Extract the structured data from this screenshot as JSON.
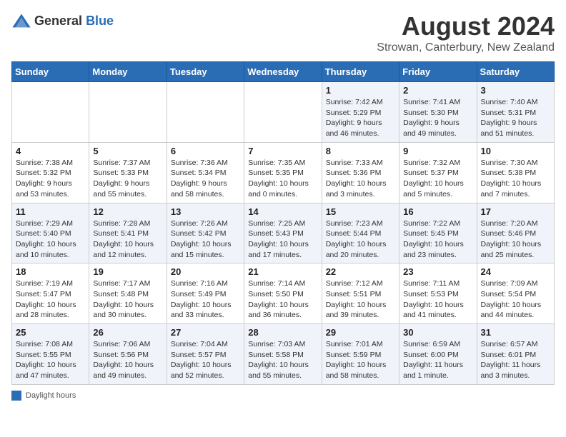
{
  "header": {
    "logo_general": "General",
    "logo_blue": "Blue",
    "main_title": "August 2024",
    "sub_title": "Strowan, Canterbury, New Zealand"
  },
  "days_of_week": [
    "Sunday",
    "Monday",
    "Tuesday",
    "Wednesday",
    "Thursday",
    "Friday",
    "Saturday"
  ],
  "footer": {
    "label": "Daylight hours"
  },
  "weeks": [
    [
      {
        "day": "",
        "info": ""
      },
      {
        "day": "",
        "info": ""
      },
      {
        "day": "",
        "info": ""
      },
      {
        "day": "",
        "info": ""
      },
      {
        "day": "1",
        "info": "Sunrise: 7:42 AM\nSunset: 5:29 PM\nDaylight: 9 hours and 46 minutes."
      },
      {
        "day": "2",
        "info": "Sunrise: 7:41 AM\nSunset: 5:30 PM\nDaylight: 9 hours and 49 minutes."
      },
      {
        "day": "3",
        "info": "Sunrise: 7:40 AM\nSunset: 5:31 PM\nDaylight: 9 hours and 51 minutes."
      }
    ],
    [
      {
        "day": "4",
        "info": "Sunrise: 7:38 AM\nSunset: 5:32 PM\nDaylight: 9 hours and 53 minutes."
      },
      {
        "day": "5",
        "info": "Sunrise: 7:37 AM\nSunset: 5:33 PM\nDaylight: 9 hours and 55 minutes."
      },
      {
        "day": "6",
        "info": "Sunrise: 7:36 AM\nSunset: 5:34 PM\nDaylight: 9 hours and 58 minutes."
      },
      {
        "day": "7",
        "info": "Sunrise: 7:35 AM\nSunset: 5:35 PM\nDaylight: 10 hours and 0 minutes."
      },
      {
        "day": "8",
        "info": "Sunrise: 7:33 AM\nSunset: 5:36 PM\nDaylight: 10 hours and 3 minutes."
      },
      {
        "day": "9",
        "info": "Sunrise: 7:32 AM\nSunset: 5:37 PM\nDaylight: 10 hours and 5 minutes."
      },
      {
        "day": "10",
        "info": "Sunrise: 7:30 AM\nSunset: 5:38 PM\nDaylight: 10 hours and 7 minutes."
      }
    ],
    [
      {
        "day": "11",
        "info": "Sunrise: 7:29 AM\nSunset: 5:40 PM\nDaylight: 10 hours and 10 minutes."
      },
      {
        "day": "12",
        "info": "Sunrise: 7:28 AM\nSunset: 5:41 PM\nDaylight: 10 hours and 12 minutes."
      },
      {
        "day": "13",
        "info": "Sunrise: 7:26 AM\nSunset: 5:42 PM\nDaylight: 10 hours and 15 minutes."
      },
      {
        "day": "14",
        "info": "Sunrise: 7:25 AM\nSunset: 5:43 PM\nDaylight: 10 hours and 17 minutes."
      },
      {
        "day": "15",
        "info": "Sunrise: 7:23 AM\nSunset: 5:44 PM\nDaylight: 10 hours and 20 minutes."
      },
      {
        "day": "16",
        "info": "Sunrise: 7:22 AM\nSunset: 5:45 PM\nDaylight: 10 hours and 23 minutes."
      },
      {
        "day": "17",
        "info": "Sunrise: 7:20 AM\nSunset: 5:46 PM\nDaylight: 10 hours and 25 minutes."
      }
    ],
    [
      {
        "day": "18",
        "info": "Sunrise: 7:19 AM\nSunset: 5:47 PM\nDaylight: 10 hours and 28 minutes."
      },
      {
        "day": "19",
        "info": "Sunrise: 7:17 AM\nSunset: 5:48 PM\nDaylight: 10 hours and 30 minutes."
      },
      {
        "day": "20",
        "info": "Sunrise: 7:16 AM\nSunset: 5:49 PM\nDaylight: 10 hours and 33 minutes."
      },
      {
        "day": "21",
        "info": "Sunrise: 7:14 AM\nSunset: 5:50 PM\nDaylight: 10 hours and 36 minutes."
      },
      {
        "day": "22",
        "info": "Sunrise: 7:12 AM\nSunset: 5:51 PM\nDaylight: 10 hours and 39 minutes."
      },
      {
        "day": "23",
        "info": "Sunrise: 7:11 AM\nSunset: 5:53 PM\nDaylight: 10 hours and 41 minutes."
      },
      {
        "day": "24",
        "info": "Sunrise: 7:09 AM\nSunset: 5:54 PM\nDaylight: 10 hours and 44 minutes."
      }
    ],
    [
      {
        "day": "25",
        "info": "Sunrise: 7:08 AM\nSunset: 5:55 PM\nDaylight: 10 hours and 47 minutes."
      },
      {
        "day": "26",
        "info": "Sunrise: 7:06 AM\nSunset: 5:56 PM\nDaylight: 10 hours and 49 minutes."
      },
      {
        "day": "27",
        "info": "Sunrise: 7:04 AM\nSunset: 5:57 PM\nDaylight: 10 hours and 52 minutes."
      },
      {
        "day": "28",
        "info": "Sunrise: 7:03 AM\nSunset: 5:58 PM\nDaylight: 10 hours and 55 minutes."
      },
      {
        "day": "29",
        "info": "Sunrise: 7:01 AM\nSunset: 5:59 PM\nDaylight: 10 hours and 58 minutes."
      },
      {
        "day": "30",
        "info": "Sunrise: 6:59 AM\nSunset: 6:00 PM\nDaylight: 11 hours and 1 minute."
      },
      {
        "day": "31",
        "info": "Sunrise: 6:57 AM\nSunset: 6:01 PM\nDaylight: 11 hours and 3 minutes."
      }
    ]
  ]
}
